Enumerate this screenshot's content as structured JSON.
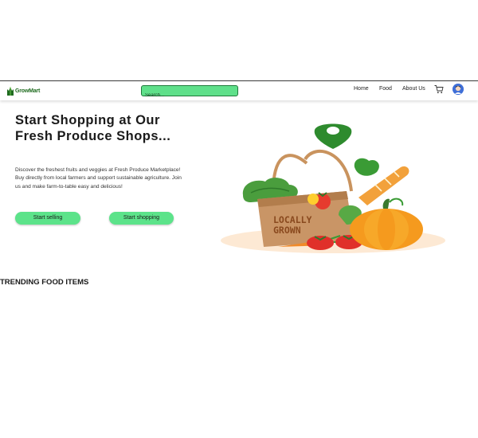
{
  "navbar": {
    "brand": "GrowMart",
    "search_placeholder": "Search...",
    "links": [
      "Home",
      "Food",
      "About Us"
    ],
    "icons": [
      "grow-leaf-logo",
      "cart-icon",
      "user-avatar-icon"
    ]
  },
  "hero": {
    "title": "Start Shopping at Our Fresh Produce Shops...",
    "description": "Discover the freshest fruits and veggies at Fresh Produce Marketplace! Buy directly from local farmers and support sustainable agriculture. Join us and make farm-to-table easy and delicious!",
    "buttons": {
      "sell": "Start selling",
      "shop": "Start shopping"
    },
    "illustration": {
      "bag_text_line1": "LOCALLY",
      "bag_text_line2": "GROWN"
    }
  },
  "trending": {
    "title": "TRENDING FOOD ITEMS"
  },
  "colors": {
    "accent": "#5ce38a",
    "brand_green": "#1f6b1f",
    "pin_green": "#2e8b2e"
  }
}
